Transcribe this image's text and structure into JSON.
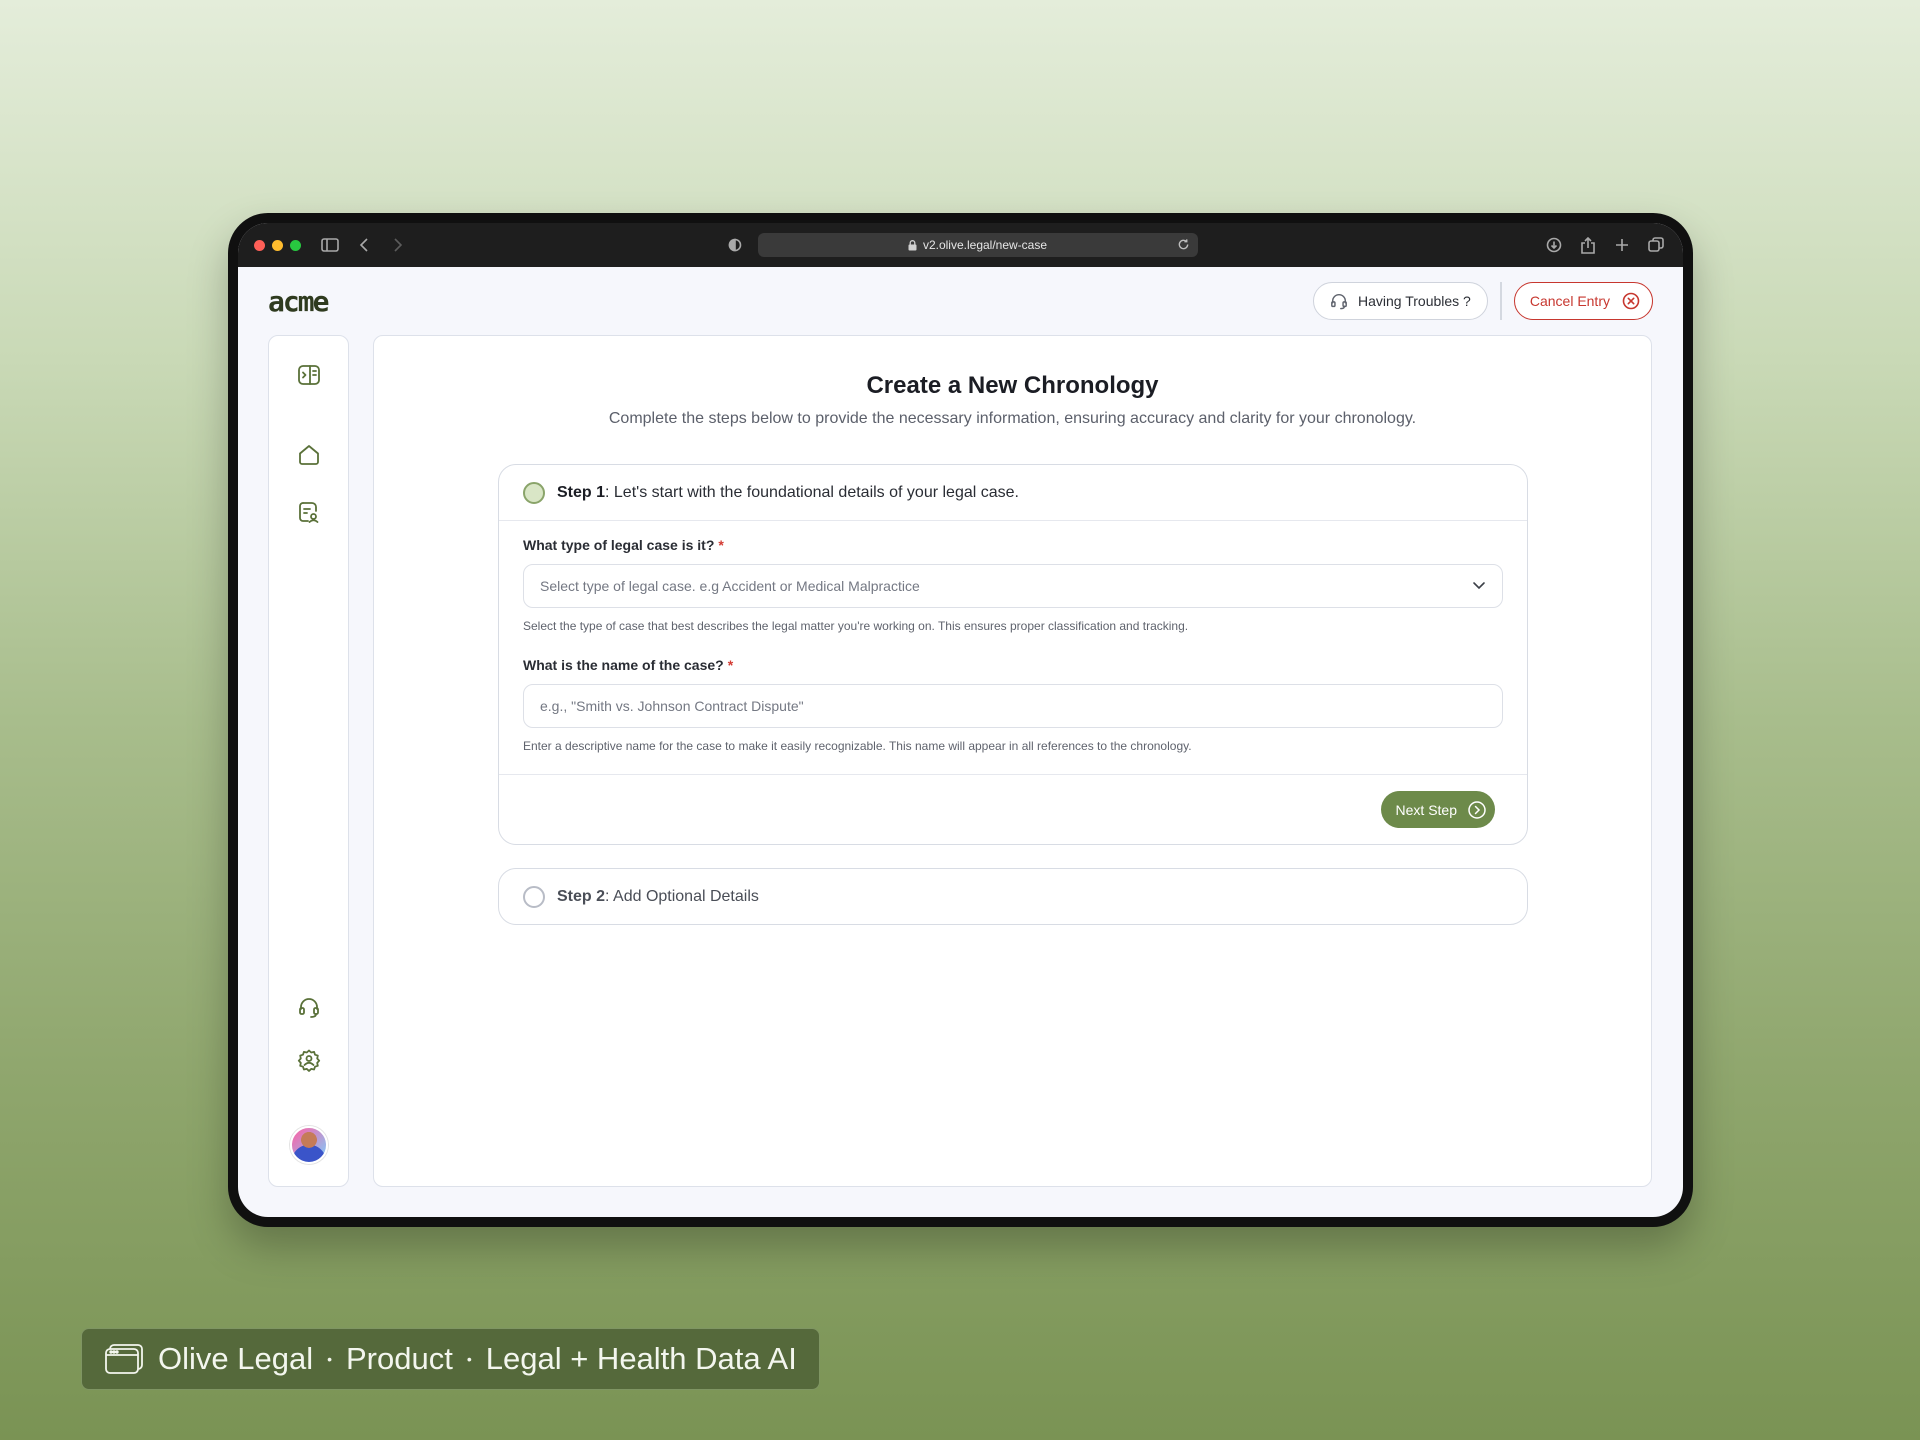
{
  "browser": {
    "url": "v2.olive.legal/new-case"
  },
  "app": {
    "logo": "acme",
    "header": {
      "troubles_label": "Having Troubles ?",
      "cancel_label": "Cancel Entry"
    },
    "sidebar": {
      "items": [
        {
          "name": "panel-toggle-icon"
        },
        {
          "name": "home-icon"
        },
        {
          "name": "documents-icon"
        },
        {
          "name": "support-icon"
        },
        {
          "name": "settings-icon"
        },
        {
          "name": "avatar"
        }
      ]
    },
    "main": {
      "title": "Create a New Chronology",
      "subtitle": "Complete the steps below to provide the necessary information, ensuring accuracy and clarity for your chronology.",
      "step1": {
        "prefix": "Step 1",
        "text": ": Let's start with the foundational details of your legal case.",
        "q1_label": "What type of legal case is it?",
        "q1_required": "*",
        "q1_placeholder": "Select type of legal case. e.g Accident or Medical Malpractice",
        "q1_help": "Select the type of case that best describes the legal matter you're working on. This ensures proper classification and tracking.",
        "q2_label": "What is the name of the case?",
        "q2_required": "*",
        "q2_placeholder": "e.g., \"Smith vs. Johnson Contract Dispute\"",
        "q2_help": "Enter a descriptive name for the case to make it easily recognizable. This name will appear in all references to the chronology.",
        "next_label": "Next Step"
      },
      "step2": {
        "prefix": "Step 2",
        "text": ": Add Optional Details"
      }
    }
  },
  "caption": {
    "part1": "Olive Legal",
    "part2": "Product",
    "part3": "Legal + Health Data AI",
    "separator": "•"
  },
  "colors": {
    "accent": "#6d8a4a",
    "danger": "#c7372f",
    "caption_bg": "#55693b"
  }
}
